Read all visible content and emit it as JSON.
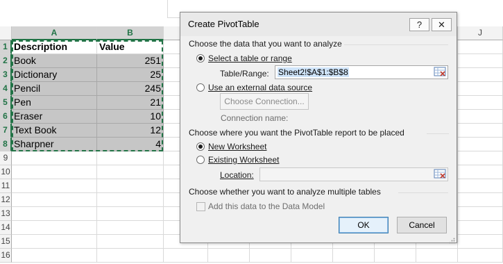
{
  "sheet": {
    "columns": [
      "A",
      "B",
      "",
      "",
      "",
      "",
      "",
      "",
      "",
      "J"
    ],
    "rows": [
      "1",
      "2",
      "3",
      "4",
      "5",
      "6",
      "7",
      "8",
      "9",
      "10",
      "11",
      "12",
      "13",
      "14",
      "15",
      "16"
    ],
    "header": {
      "description": "Description",
      "value": "Value"
    },
    "data": [
      {
        "description": "Book",
        "value": "251"
      },
      {
        "description": "Dictionary",
        "value": "25"
      },
      {
        "description": "Pencil",
        "value": "245"
      },
      {
        "description": "Pen",
        "value": "21"
      },
      {
        "description": "Eraser",
        "value": "10"
      },
      {
        "description": "Text Book",
        "value": "12"
      },
      {
        "description": "Sharpner",
        "value": "4"
      }
    ]
  },
  "dialog": {
    "title": "Create PivotTable",
    "help_label": "?",
    "close_label": "✕",
    "section_data": "Choose the data that you want to analyze",
    "opt_table_range": "Select a table or range",
    "table_range_label": "Table/Range:",
    "table_range_value": "Sheet2!$A$1:$B$8",
    "opt_external": "Use an external data source",
    "choose_connection": "Choose Connection...",
    "connection_name_label": "Connection name:",
    "section_place": "Choose where you want the PivotTable report to be placed",
    "opt_new_ws": "New Worksheet",
    "opt_existing_ws": "Existing Worksheet",
    "location_label": "Location:",
    "location_value": "",
    "section_multi": "Choose whether you want to analyze multiple tables",
    "data_model_label": "Add this data to the Data Model",
    "ok_label": "OK",
    "cancel_label": "Cancel"
  },
  "colors": {
    "excel_green": "#217346",
    "selection_gray": "#c6c6c6"
  }
}
